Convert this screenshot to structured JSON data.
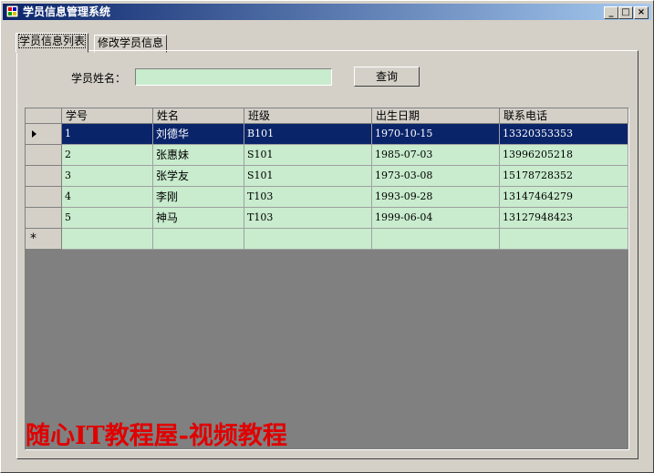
{
  "window": {
    "title": "学员信息管理系统",
    "controls": {
      "min": "_",
      "max": "□",
      "close": "×"
    }
  },
  "tabs": [
    {
      "label": "学员信息列表",
      "active": true
    },
    {
      "label": "修改学员信息",
      "active": false
    }
  ],
  "search": {
    "label": "学员姓名：",
    "value": "",
    "button": "查询"
  },
  "grid": {
    "columns": [
      "学号",
      "姓名",
      "班级",
      "出生日期",
      "联系电话"
    ],
    "rows": [
      [
        "1",
        "刘德华",
        "B101",
        "1970-10-15",
        "13320353353"
      ],
      [
        "2",
        "张惠妹",
        "S101",
        "1985-07-03",
        "13996205218"
      ],
      [
        "3",
        "张学友",
        "S101",
        "1973-03-08",
        "15178728352"
      ],
      [
        "4",
        "李刚",
        "T103",
        "1993-09-28",
        "13147464279"
      ],
      [
        "5",
        "神马",
        "T103",
        "1999-06-04",
        "13127948423"
      ]
    ],
    "selected_row": 1,
    "new_row_marker": "*",
    "colors": {
      "cell_bg": "#c8eccd",
      "selection": "#0a246a",
      "empty_area": "#808080"
    }
  },
  "watermark": {
    "text": "随心IT教程屋-视频教程",
    "color": "#e00000"
  }
}
